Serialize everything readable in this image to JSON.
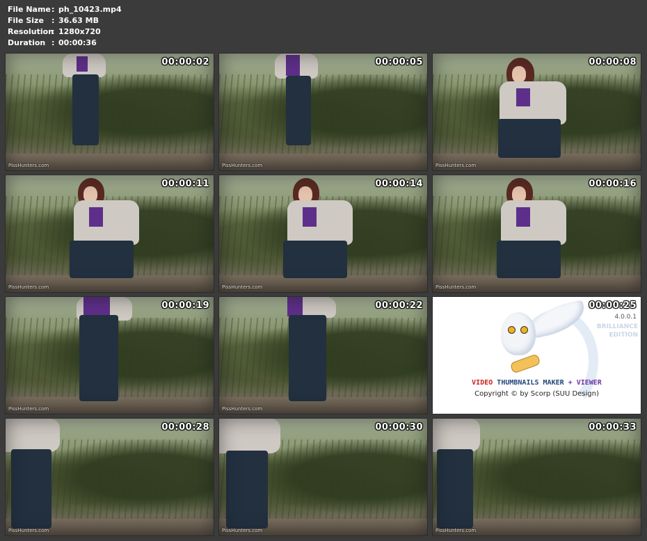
{
  "file_info": [
    {
      "key": "File Name",
      "sep": ":",
      "value": "ph_10423.mp4"
    },
    {
      "key": "File Size",
      "sep": ":",
      "value": "36.63 MB"
    },
    {
      "key": "Resolution",
      "sep": ":",
      "value": "1280x720"
    },
    {
      "key": "Duration",
      "sep": ":",
      "value": "00:00:36"
    }
  ],
  "watermark": "PissHunters.com",
  "thumbnails": [
    {
      "time": "00:00:02",
      "scene": "standing"
    },
    {
      "time": "00:00:05",
      "scene": "standing"
    },
    {
      "time": "00:00:08",
      "scene": "squatting"
    },
    {
      "time": "00:00:11",
      "scene": "squatting"
    },
    {
      "time": "00:00:14",
      "scene": "squatting"
    },
    {
      "time": "00:00:16",
      "scene": "squatting"
    },
    {
      "time": "00:00:19",
      "scene": "standing"
    },
    {
      "time": "00:00:22",
      "scene": "standing"
    },
    {
      "time": "00:00:25",
      "scene": "logo"
    },
    {
      "time": "00:00:28",
      "scene": "close"
    },
    {
      "time": "00:00:30",
      "scene": "close"
    },
    {
      "time": "00:00:33",
      "scene": "close"
    }
  ],
  "logo": {
    "version": "4.0.0.1",
    "edition_line1": "BRILLIANCE",
    "edition_line2": "EDITION",
    "product_part1": "VIDEO",
    "product_part2": "THUMBNAILS MAKER",
    "product_part3": "+ VIEWER",
    "copyright": "Copyright © by Scorp (SUU Design)"
  }
}
